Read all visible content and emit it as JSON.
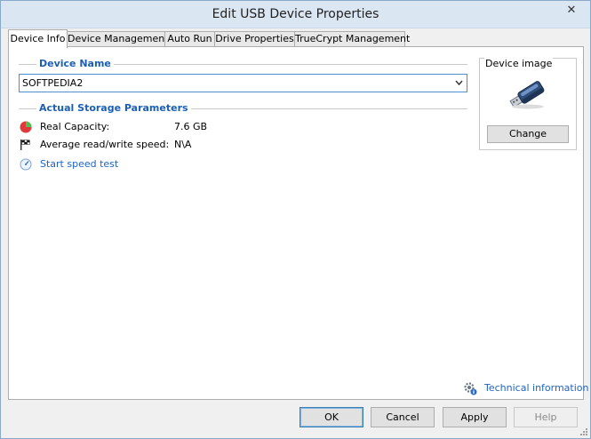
{
  "window": {
    "title": "Edit USB Device Properties",
    "close_glyph": "✕"
  },
  "tabs": [
    {
      "label": "Device Info",
      "active": true
    },
    {
      "label": "Device Management",
      "active": false
    },
    {
      "label": "Auto Run",
      "active": false
    },
    {
      "label": "Drive Properties",
      "active": false
    },
    {
      "label": "TrueCrypt Management",
      "active": false
    }
  ],
  "device_name": {
    "heading": "Device Name",
    "value": "SOFTPEDIA2",
    "dropdown_icon": "chevron-down-icon"
  },
  "storage": {
    "heading": "Actual Storage Parameters",
    "real_capacity_label": "Real Capacity:",
    "real_capacity_value": "7.6 GB",
    "speed_label": "Average read/write speed:",
    "speed_value": "N\\A",
    "speed_test_link": "Start speed test"
  },
  "device_image": {
    "title": "Device image",
    "icon": "usb-drive-icon",
    "change_label": "Change"
  },
  "technical_info_link": "Technical information",
  "buttons": {
    "ok": "OK",
    "cancel": "Cancel",
    "apply": "Apply",
    "help": "Help"
  },
  "colors": {
    "accent": "#1b5fb5",
    "link": "#1c64c4",
    "titlebar": "#dbe6f3"
  }
}
